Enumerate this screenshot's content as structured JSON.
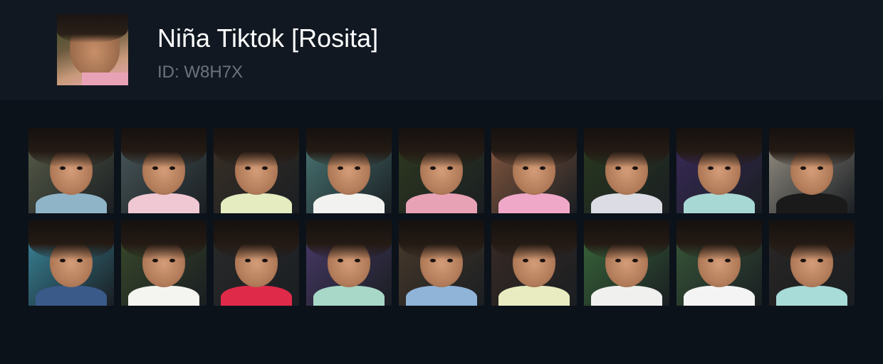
{
  "profile": {
    "name": "Niña Tiktok [Rosita]",
    "id_label": "ID: W8H7X"
  },
  "thumbnails": [
    {
      "icon": "photo-thumbnail",
      "bg": "#5a5f4a",
      "shirt": "#8fb4c8"
    },
    {
      "icon": "photo-thumbnail",
      "bg": "#4a5a5c",
      "shirt": "#f0c8d4"
    },
    {
      "icon": "photo-thumbnail",
      "bg": "#3a3026",
      "shirt": "#e4ecc0"
    },
    {
      "icon": "photo-thumbnail",
      "bg": "#4c7a78",
      "shirt": "#f2f2f0"
    },
    {
      "icon": "photo-thumbnail",
      "bg": "#2e3a1e",
      "shirt": "#e8a2b6"
    },
    {
      "icon": "photo-thumbnail",
      "bg": "#8a5a40",
      "shirt": "#f0a8c8"
    },
    {
      "icon": "photo-thumbnail",
      "bg": "#2a3a1e",
      "shirt": "#dcdce4"
    },
    {
      "icon": "photo-thumbnail",
      "bg": "#3a2a5a",
      "shirt": "#a8d8d4"
    },
    {
      "icon": "photo-thumbnail",
      "bg": "#9a9488",
      "shirt": "#1a1a1a"
    },
    {
      "icon": "photo-thumbnail",
      "bg": "#3a8aa0",
      "shirt": "#3a5a8a"
    },
    {
      "icon": "photo-thumbnail",
      "bg": "#3a4a2a",
      "shirt": "#f4f4f0"
    },
    {
      "icon": "photo-thumbnail",
      "bg": "#2a2a2a",
      "shirt": "#e02a4a"
    },
    {
      "icon": "photo-thumbnail",
      "bg": "#4a3a6a",
      "shirt": "#a8d8c8"
    },
    {
      "icon": "photo-thumbnail",
      "bg": "#4a3a2a",
      "shirt": "#8fb4d8"
    },
    {
      "icon": "photo-thumbnail",
      "bg": "#3a2a24",
      "shirt": "#e8ecc0"
    },
    {
      "icon": "photo-thumbnail",
      "bg": "#3a6a3a",
      "shirt": "#f0f0ee"
    },
    {
      "icon": "photo-thumbnail",
      "bg": "#3a5a3a",
      "shirt": "#f4f4f4"
    },
    {
      "icon": "photo-thumbnail",
      "bg": "#2a2624",
      "shirt": "#a8dcd8"
    }
  ]
}
